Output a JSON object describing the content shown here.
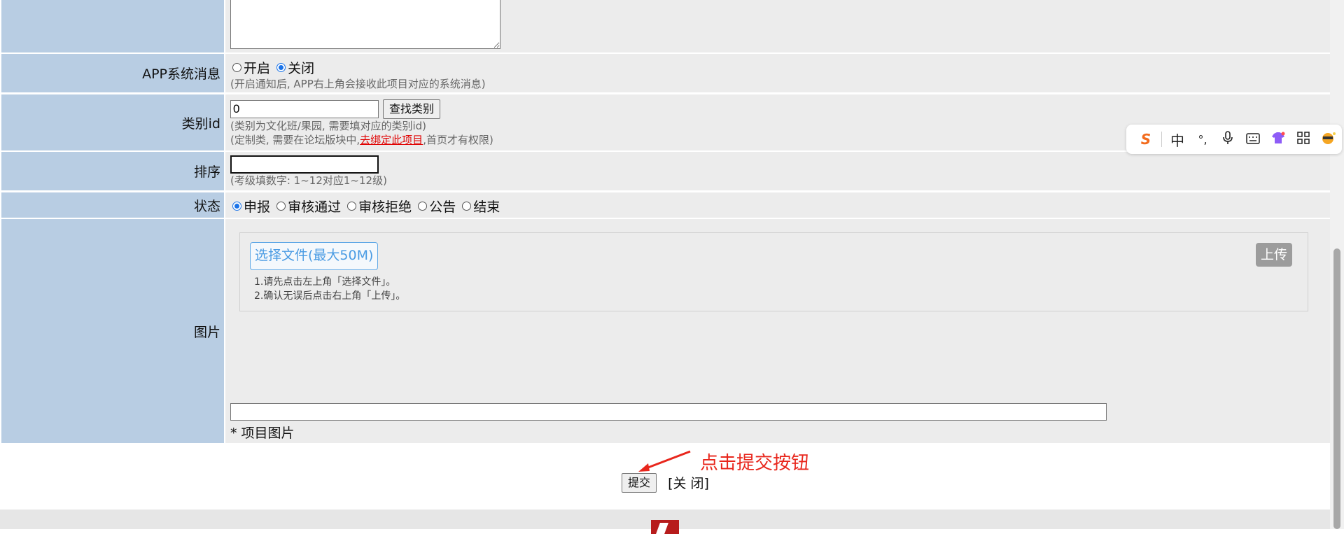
{
  "rows": {
    "app_msg": {
      "label": "APP系统消息",
      "options": [
        "开启",
        "关闭"
      ],
      "selected": "关闭",
      "hint": "(开启通知后, APP右上角会接收此项目对应的系统消息)"
    },
    "category": {
      "label": "类别id",
      "value": "0",
      "button": "查找类别",
      "hint1": "(类别为文化班/果园, 需要填对应的类别id)",
      "hint2_pre": "(定制类, 需要在论坛版块中,",
      "hint2_link": "去绑定此项目",
      "hint2_post": ",首页才有权限)"
    },
    "sort": {
      "label": "排序",
      "value": "",
      "hint": "(考级填数字: 1~12对应1~12级)"
    },
    "status": {
      "label": "状态",
      "options": [
        "申报",
        "审核通过",
        "审核拒绝",
        "公告",
        "结束"
      ],
      "selected": "申报"
    },
    "image": {
      "label": "图片",
      "select_file": "选择文件(最大50M)",
      "upload": "上传",
      "tip1": "1.请先点击左上角「选择文件」。",
      "tip2": "2.确认无误后点击右上角「上传」。",
      "note": "* 项目图片"
    }
  },
  "actions": {
    "submit": "提交",
    "close": "[关 闭]"
  },
  "annotation": "点击提交按钮",
  "ime": {
    "brand_glyph": "S",
    "mode": "中",
    "punct": "°,",
    "items": [
      "mic-icon",
      "keyboard-icon",
      "skin-icon",
      "grid-icon",
      "avatar-icon"
    ]
  }
}
